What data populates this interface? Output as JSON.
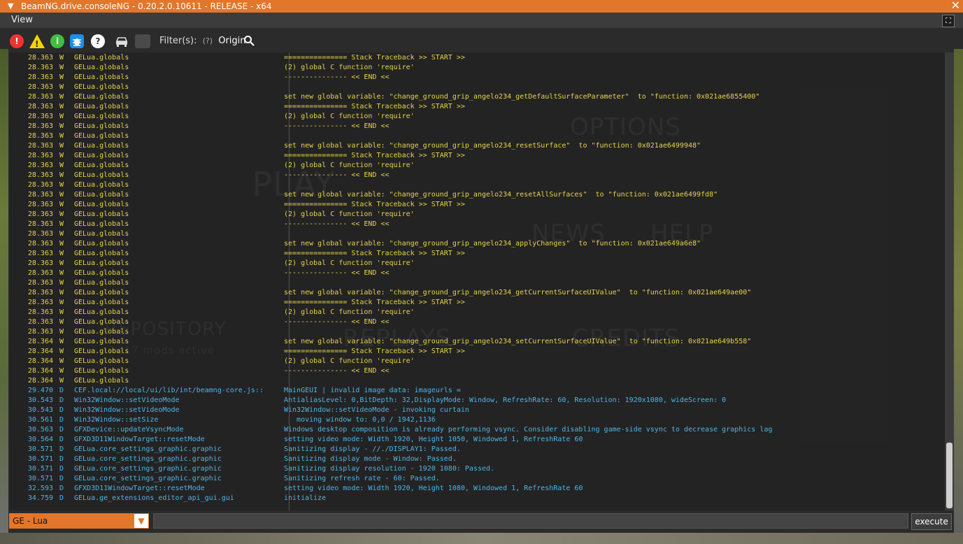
{
  "window": {
    "title": "BeamNG.drive.consoleNG - 0.20.2.0.10611 - RELEASE - x64"
  },
  "menu": {
    "view": "View"
  },
  "toolbar": {
    "error_glyph": "!",
    "warn_glyph": "!",
    "info_glyph": "i",
    "help_glyph": "?",
    "filters_label": "Filter(s):",
    "filters_hint": "(?)",
    "origin_label": "Origin"
  },
  "background_words": [
    "OPTIONS",
    "PLAY",
    "NEWS",
    "HELP",
    "REPOSITORY",
    "REPLAYS",
    "CREDITS",
    "f 117 mods active"
  ],
  "log": {
    "rows": [
      {
        "t": "28.363",
        "l": "W",
        "o": "GELua.globals",
        "m": "=============== Stack Traceback >> START >>"
      },
      {
        "t": "28.363",
        "l": "W",
        "o": "GELua.globals",
        "m": "(2) global C function 'require'"
      },
      {
        "t": "28.363",
        "l": "W",
        "o": "GELua.globals",
        "m": "--------------- << END <<"
      },
      {
        "t": "28.363",
        "l": "W",
        "o": "GELua.globals",
        "m": ""
      },
      {
        "t": "28.363",
        "l": "W",
        "o": "GELua.globals",
        "m": "set new global variable: \"change_ground_grip_angelo234_getDefaultSurfaceParameter\"  to \"function: 0x021ae6855400\""
      },
      {
        "t": "28.363",
        "l": "W",
        "o": "GELua.globals",
        "m": "=============== Stack Traceback >> START >>"
      },
      {
        "t": "28.363",
        "l": "W",
        "o": "GELua.globals",
        "m": "(2) global C function 'require'"
      },
      {
        "t": "28.363",
        "l": "W",
        "o": "GELua.globals",
        "m": "--------------- << END <<"
      },
      {
        "t": "28.363",
        "l": "W",
        "o": "GELua.globals",
        "m": ""
      },
      {
        "t": "28.363",
        "l": "W",
        "o": "GELua.globals",
        "m": "set new global variable: \"change_ground_grip_angelo234_resetSurface\"  to \"function: 0x021ae6499948\""
      },
      {
        "t": "28.363",
        "l": "W",
        "o": "GELua.globals",
        "m": "=============== Stack Traceback >> START >>"
      },
      {
        "t": "28.363",
        "l": "W",
        "o": "GELua.globals",
        "m": "(2) global C function 'require'"
      },
      {
        "t": "28.363",
        "l": "W",
        "o": "GELua.globals",
        "m": "--------------- << END <<"
      },
      {
        "t": "28.363",
        "l": "W",
        "o": "GELua.globals",
        "m": ""
      },
      {
        "t": "28.363",
        "l": "W",
        "o": "GELua.globals",
        "m": "set new global variable: \"change_ground_grip_angelo234_resetAllSurfaces\"  to \"function: 0x021ae6499fd8\""
      },
      {
        "t": "28.363",
        "l": "W",
        "o": "GELua.globals",
        "m": "=============== Stack Traceback >> START >>"
      },
      {
        "t": "28.363",
        "l": "W",
        "o": "GELua.globals",
        "m": "(2) global C function 'require'"
      },
      {
        "t": "28.363",
        "l": "W",
        "o": "GELua.globals",
        "m": "--------------- << END <<"
      },
      {
        "t": "28.363",
        "l": "W",
        "o": "GELua.globals",
        "m": ""
      },
      {
        "t": "28.363",
        "l": "W",
        "o": "GELua.globals",
        "m": "set new global variable: \"change_ground_grip_angelo234_applyChanges\"  to \"function: 0x021ae649a6e8\""
      },
      {
        "t": "28.363",
        "l": "W",
        "o": "GELua.globals",
        "m": "=============== Stack Traceback >> START >>"
      },
      {
        "t": "28.363",
        "l": "W",
        "o": "GELua.globals",
        "m": "(2) global C function 'require'"
      },
      {
        "t": "28.363",
        "l": "W",
        "o": "GELua.globals",
        "m": "--------------- << END <<"
      },
      {
        "t": "28.363",
        "l": "W",
        "o": "GELua.globals",
        "m": ""
      },
      {
        "t": "28.363",
        "l": "W",
        "o": "GELua.globals",
        "m": "set new global variable: \"change_ground_grip_angelo234_getCurrentSurfaceUIValue\"  to \"function: 0x021ae649ae00\""
      },
      {
        "t": "28.363",
        "l": "W",
        "o": "GELua.globals",
        "m": "=============== Stack Traceback >> START >>"
      },
      {
        "t": "28.363",
        "l": "W",
        "o": "GELua.globals",
        "m": "(2) global C function 'require'"
      },
      {
        "t": "28.363",
        "l": "W",
        "o": "GELua.globals",
        "m": "--------------- << END <<"
      },
      {
        "t": "28.363",
        "l": "W",
        "o": "GELua.globals",
        "m": ""
      },
      {
        "t": "28.364",
        "l": "W",
        "o": "GELua.globals",
        "m": "set new global variable: \"change_ground_grip_angelo234_setCurrentSurfaceUIValue\"  to \"function: 0x021ae649b558\""
      },
      {
        "t": "28.364",
        "l": "W",
        "o": "GELua.globals",
        "m": "=============== Stack Traceback >> START >>"
      },
      {
        "t": "28.364",
        "l": "W",
        "o": "GELua.globals",
        "m": "(2) global C function 'require'"
      },
      {
        "t": "28.364",
        "l": "W",
        "o": "GELua.globals",
        "m": "--------------- << END <<"
      },
      {
        "t": "28.364",
        "l": "W",
        "o": "GELua.globals",
        "m": ""
      },
      {
        "t": "29.470",
        "l": "D",
        "o": "CEF.local://local/ui/lib/int/beamng-core.js::",
        "m": "MainGEUI | invalid image data: imageurls ="
      },
      {
        "t": "30.543",
        "l": "D",
        "o": "Win32Window::setVideoMode",
        "m": "AntialiasLevel: 0,BitDepth: 32,DisplayMode: Window, RefreshRate: 60, Resolution: 1920x1080, wideScreen: 0"
      },
      {
        "t": "30.543",
        "l": "D",
        "o": "Win32Window::setVideoMode",
        "m": "Win32Window::setVideoMode - invoking curtain"
      },
      {
        "t": "30.561",
        "l": "D",
        "o": "Win32Window::setSize",
        "m": "   moving window to: 0,0 / 1942,1136"
      },
      {
        "t": "30.563",
        "l": "D",
        "o": "GFXDevice::updateVsyncMode",
        "m": "Windows desktop composition is already performing vsync. Consider disabling game-side vsync to decrease graphics lag"
      },
      {
        "t": "30.564",
        "l": "D",
        "o": "GFXD3D11WindowTarget::resetMode",
        "m": "setting video mode: Width 1920, Height 1050, Windowed 1, RefreshRate 60"
      },
      {
        "t": "30.571",
        "l": "D",
        "o": "GELua.core_settings_graphic.graphic",
        "m": "Sanitizing display - //./DISPLAY1: Passed."
      },
      {
        "t": "30.571",
        "l": "D",
        "o": "GELua.core_settings_graphic.graphic",
        "m": "Sanitizing display mode - Window: Passed."
      },
      {
        "t": "30.571",
        "l": "D",
        "o": "GELua.core_settings_graphic.graphic",
        "m": "Sanitizing display resolution - 1920 1080: Passed."
      },
      {
        "t": "30.571",
        "l": "D",
        "o": "GELua.core_settings_graphic.graphic",
        "m": "Sanitizing refresh rate - 60: Passed."
      },
      {
        "t": "32.593",
        "l": "D",
        "o": "GFXD3D11WindowTarget::resetMode",
        "m": "setting video mode: Width 1920, Height 1080, Windowed 1, RefreshRate 60"
      },
      {
        "t": "34.759",
        "l": "D",
        "o": "GELua.ge_extensions_editor_api_gui.gui",
        "m": "initialize"
      }
    ]
  },
  "bottom": {
    "vm_selected": "GE - Lua",
    "execute_label": "execute",
    "command_value": ""
  }
}
